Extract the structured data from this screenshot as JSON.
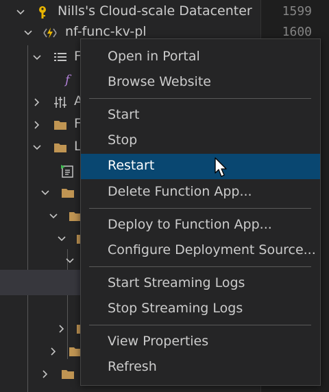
{
  "tree": {
    "rows": [
      {
        "label": "Nills's Cloud-scale Datacenter",
        "icon": "key-icon"
      },
      {
        "label": "nf-func-kv-pl",
        "icon": "function-app-icon"
      },
      {
        "label": "F",
        "icon": "list-icon"
      },
      {
        "label": "",
        "icon": "function-icon"
      },
      {
        "label": "A",
        "icon": "settings-sliders-icon"
      },
      {
        "label": "F",
        "icon": "folder-icon"
      },
      {
        "label": "L",
        "icon": "folder-icon"
      },
      {
        "label": "",
        "icon": "log-file-icon"
      },
      {
        "label": "",
        "icon": "folder-icon"
      },
      {
        "label": "",
        "icon": "folder-icon"
      },
      {
        "label": "",
        "icon": "folder-icon"
      },
      {
        "label": "",
        "icon": "folder-icon"
      },
      {
        "label": "",
        "icon": "folder-icon"
      },
      {
        "label": "",
        "icon": "folder-icon"
      },
      {
        "label": "",
        "icon": "folder-icon"
      }
    ]
  },
  "gutter": {
    "line_numbers": [
      "1599",
      "1600"
    ]
  },
  "context_menu": {
    "groups": [
      [
        "Open in Portal",
        "Browse Website"
      ],
      [
        "Start",
        "Stop",
        "Restart",
        "Delete Function App..."
      ],
      [
        "Deploy to Function App...",
        "Configure Deployment Source..."
      ],
      [
        "Start Streaming Logs",
        "Stop Streaming Logs"
      ],
      [
        "View Properties",
        "Refresh"
      ]
    ],
    "active_item": "Restart"
  },
  "colors": {
    "background": "#252526",
    "menu_highlight": "#094771",
    "key_icon": "#e8b400",
    "bolt_icon": "#0078d4",
    "folder": "#c09553"
  }
}
